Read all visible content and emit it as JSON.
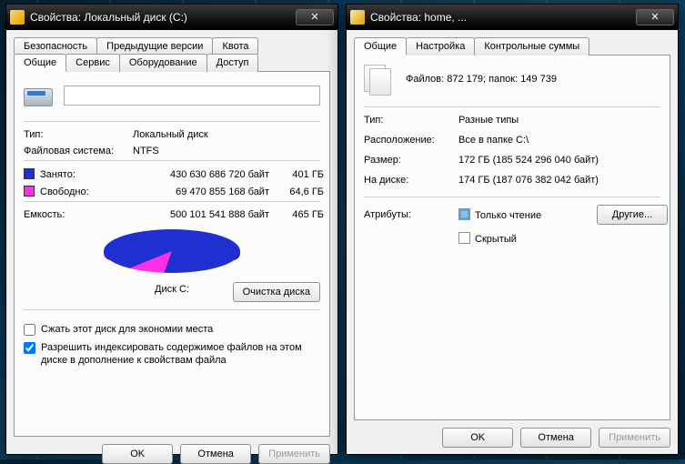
{
  "w1": {
    "title": "Свойства: Локальный диск (C:)",
    "tabs_row1": [
      "Безопасность",
      "Предыдущие версии",
      "Квота"
    ],
    "tabs_row2": [
      "Общие",
      "Сервис",
      "Оборудование",
      "Доступ"
    ],
    "active_tab": "Общие",
    "disk_name_value": "",
    "type_label": "Тип:",
    "type_value": "Локальный диск",
    "fs_label": "Файловая система:",
    "fs_value": "NTFS",
    "used_label": "Занято:",
    "used_bytes": "430 630 686 720 байт",
    "used_gb": "401 ГБ",
    "free_label": "Свободно:",
    "free_bytes": "69 470 855 168 байт",
    "free_gb": "64,6 ГБ",
    "cap_label": "Емкость:",
    "cap_bytes": "500 101 541 888 байт",
    "cap_gb": "465 ГБ",
    "pie_caption": "Диск C:",
    "cleanup_btn": "Очистка диска",
    "compress_label": "Сжать этот диск для экономии места",
    "index_label": "Разрешить индексировать содержимое файлов на этом диске в дополнение к свойствам файла",
    "compress_checked": false,
    "index_checked": true,
    "ok": "OK",
    "cancel": "Отмена",
    "apply": "Применить",
    "colors": {
      "used": "#2030d0",
      "free": "#ff30e8"
    }
  },
  "w2": {
    "title": "Свойства: home, ...",
    "tabs": [
      "Общие",
      "Настройка",
      "Контрольные суммы"
    ],
    "active_tab": "Общие",
    "summary": "Файлов: 872 179; папок: 149 739",
    "type_label": "Тип:",
    "type_value": "Разные типы",
    "loc_label": "Расположение:",
    "loc_value": "Все в папке C:\\",
    "size_label": "Размер:",
    "size_value": "172 ГБ (185 524 296 040 байт)",
    "ondisk_label": "На диске:",
    "ondisk_value": "174 ГБ (187 076 382 042 байт)",
    "attr_label": "Атрибуты:",
    "readonly_label": "Только чтение",
    "hidden_label": "Скрытый",
    "other_btn": "Другие...",
    "ok": "OK",
    "cancel": "Отмена",
    "apply": "Применить"
  },
  "chart_data": {
    "type": "pie",
    "title": "Диск C:",
    "series": [
      {
        "name": "Занято",
        "value": 430630686720,
        "display": "401 ГБ",
        "color": "#2030d0"
      },
      {
        "name": "Свободно",
        "value": 69470855168,
        "display": "64,6 ГБ",
        "color": "#ff30e8"
      }
    ],
    "total": {
      "name": "Емкость",
      "value": 500101541888,
      "display": "465 ГБ"
    }
  }
}
